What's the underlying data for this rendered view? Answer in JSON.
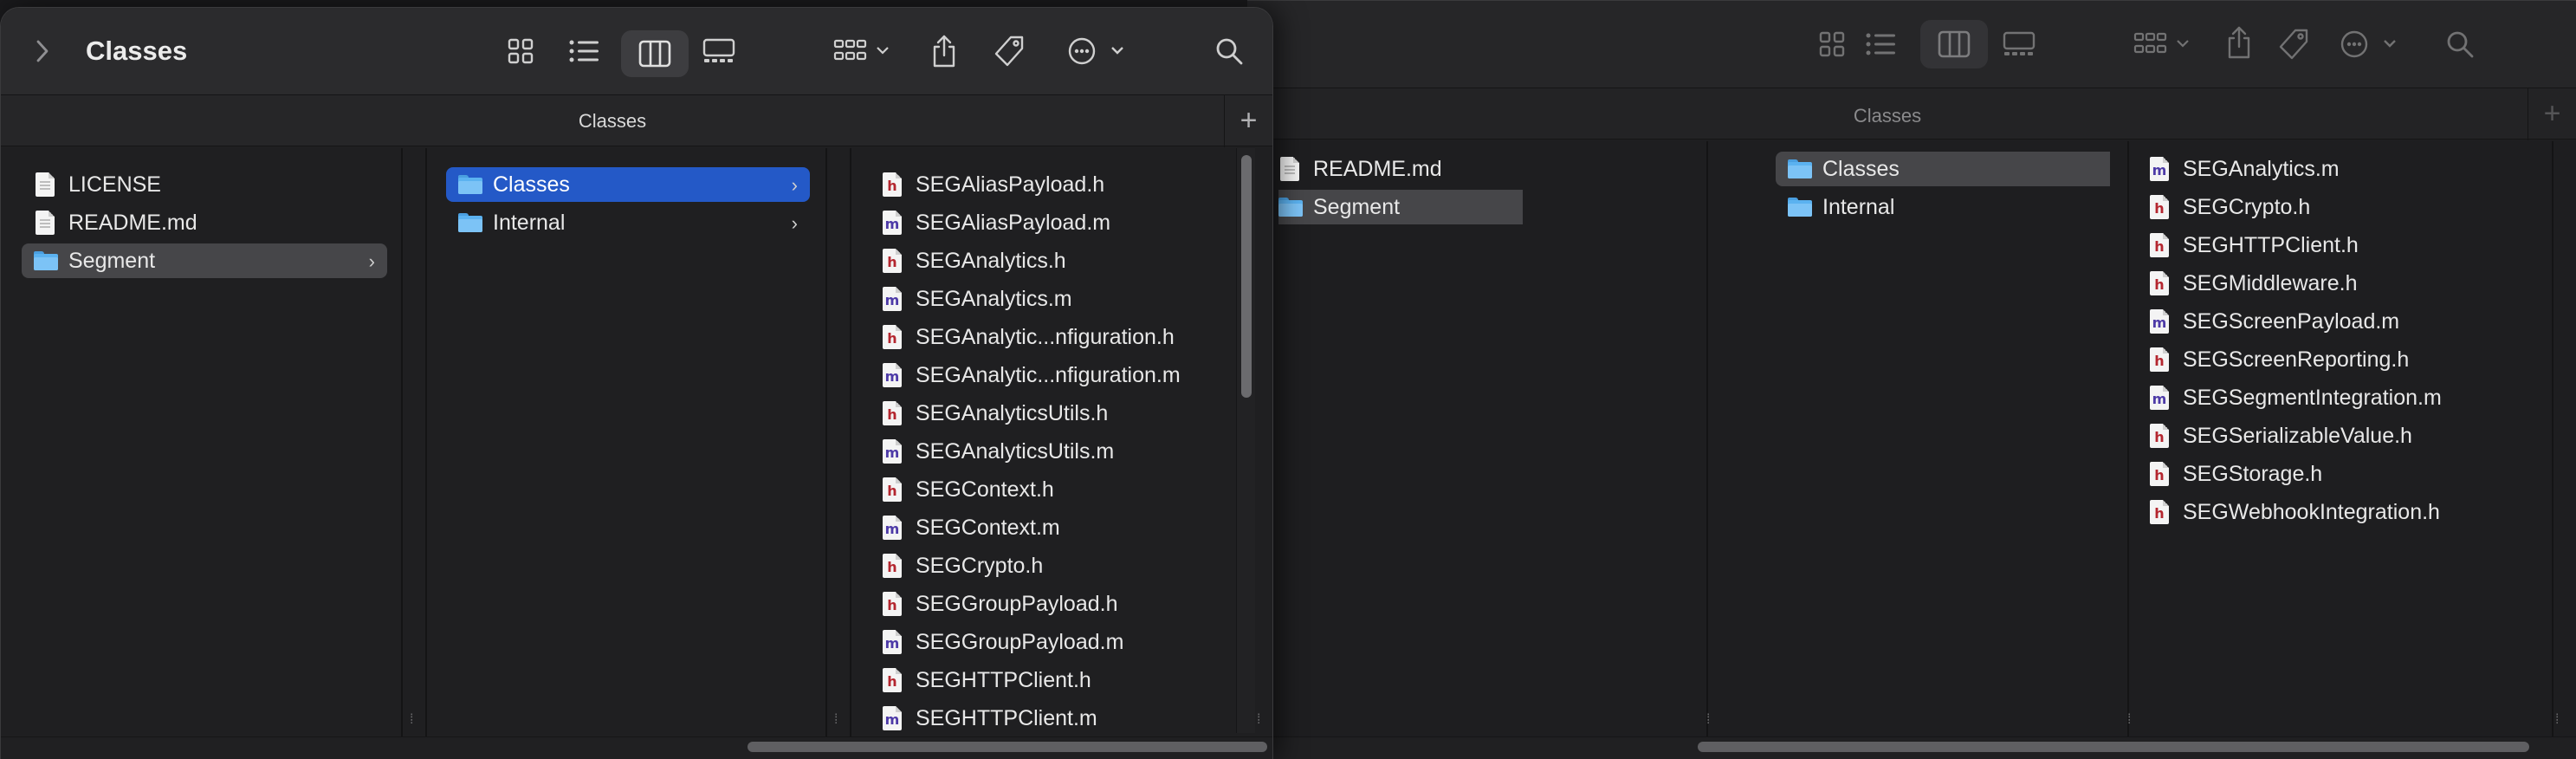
{
  "front": {
    "title": "Classes",
    "tab_title": "Classes",
    "col1": [
      {
        "name": "LICENSE",
        "icon": "plain-doc-icon",
        "kind": "plain"
      },
      {
        "name": "README.md",
        "icon": "plain-doc-icon",
        "kind": "plain"
      },
      {
        "name": "Segment",
        "icon": "folder-icon",
        "kind": "folder",
        "state": "selected-inactive"
      }
    ],
    "col2": [
      {
        "name": "Classes",
        "icon": "folder-icon",
        "kind": "folder",
        "state": "selected-active"
      },
      {
        "name": "Internal",
        "icon": "folder-icon",
        "kind": "folder"
      }
    ],
    "col3": [
      {
        "name": "SEGAliasPayload.h",
        "kind": "h"
      },
      {
        "name": "SEGAliasPayload.m",
        "kind": "m"
      },
      {
        "name": "SEGAnalytics.h",
        "kind": "h"
      },
      {
        "name": "SEGAnalytics.m",
        "kind": "m"
      },
      {
        "name": "SEGAnalytic...nfiguration.h",
        "kind": "h"
      },
      {
        "name": "SEGAnalytic...nfiguration.m",
        "kind": "m"
      },
      {
        "name": "SEGAnalyticsUtils.h",
        "kind": "h"
      },
      {
        "name": "SEGAnalyticsUtils.m",
        "kind": "m"
      },
      {
        "name": "SEGContext.h",
        "kind": "h"
      },
      {
        "name": "SEGContext.m",
        "kind": "m"
      },
      {
        "name": "SEGCrypto.h",
        "kind": "h"
      },
      {
        "name": "SEGGroupPayload.h",
        "kind": "h"
      },
      {
        "name": "SEGGroupPayload.m",
        "kind": "m"
      },
      {
        "name": "SEGHTTPClient.h",
        "kind": "h"
      },
      {
        "name": "SEGHTTPClient.m",
        "kind": "m"
      }
    ]
  },
  "back": {
    "tab_title": "Classes",
    "col1": [
      {
        "name": "README.md",
        "kind": "plain"
      },
      {
        "name": "Segment",
        "kind": "folder",
        "state": "selected-inactive"
      }
    ],
    "col2": [
      {
        "name": "Classes",
        "kind": "folder",
        "state": "selected-inactive"
      },
      {
        "name": "Internal",
        "kind": "folder"
      }
    ],
    "col3": [
      {
        "name": "SEGAnalytics.m",
        "kind": "m"
      },
      {
        "name": "SEGCrypto.h",
        "kind": "h"
      },
      {
        "name": "SEGHTTPClient.h",
        "kind": "h"
      },
      {
        "name": "SEGMiddleware.h",
        "kind": "h"
      },
      {
        "name": "SEGScreenPayload.m",
        "kind": "m"
      },
      {
        "name": "SEGScreenReporting.h",
        "kind": "h"
      },
      {
        "name": "SEGSegmentIntegration.m",
        "kind": "m"
      },
      {
        "name": "SEGSerializableValue.h",
        "kind": "h"
      },
      {
        "name": "SEGStorage.h",
        "kind": "h"
      },
      {
        "name": "SEGWebhookIntegration.h",
        "kind": "h"
      }
    ]
  },
  "toolbar": {
    "icons": [
      "chevron-right-icon",
      "icon-view-icon",
      "list-view-icon",
      "column-view-icon",
      "gallery-view-icon",
      "group-icon",
      "share-icon",
      "tag-icon",
      "more-actions-icon",
      "search-icon"
    ],
    "new_tab_symbol": "+"
  },
  "colors": {
    "selection_active": "#2459c7",
    "selection_inactive": "#464649",
    "h_file_letter": "#b4262f",
    "m_file_letter": "#4d3aa7",
    "folder": "#5bb2f0"
  }
}
